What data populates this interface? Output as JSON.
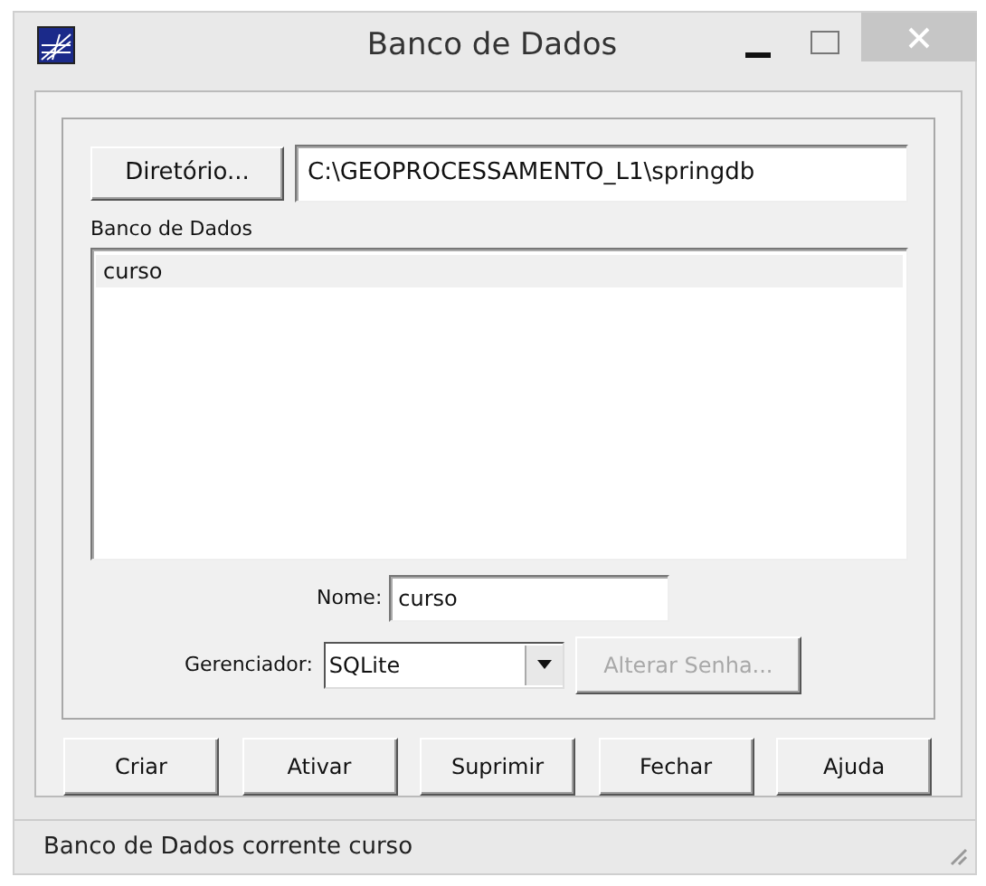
{
  "window": {
    "title": "Banco de Dados"
  },
  "directory_button": {
    "label": "Diretório..."
  },
  "directory_field": {
    "value": "C:\\GEOPROCESSAMENTO_L1\\springdb"
  },
  "list_label": "Banco de Dados",
  "databases": [
    {
      "name": "curso",
      "selected": true
    }
  ],
  "name_field": {
    "label": "Nome:",
    "value": "curso"
  },
  "manager": {
    "label": "Gerenciador:",
    "value": "SQLite"
  },
  "change_password_button": {
    "label": "Alterar Senha...",
    "disabled": true
  },
  "buttons": [
    {
      "label": "Criar"
    },
    {
      "label": "Ativar"
    },
    {
      "label": "Suprimir"
    },
    {
      "label": "Fechar"
    },
    {
      "label": "Ajuda"
    }
  ],
  "status_bar": "Banco de Dados corrente curso"
}
